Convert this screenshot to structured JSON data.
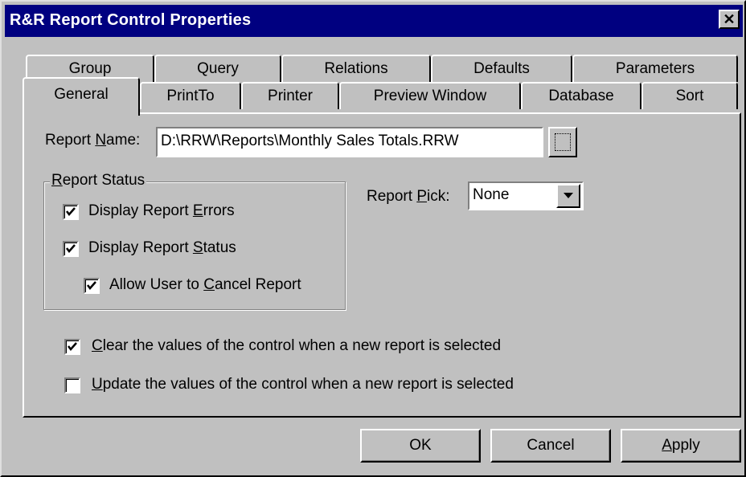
{
  "window": {
    "title": "R&R Report Control Properties"
  },
  "tabs_back": [
    {
      "label": "Group"
    },
    {
      "label": "Query"
    },
    {
      "label": "Relations"
    },
    {
      "label": "Defaults"
    },
    {
      "label": "Parameters"
    }
  ],
  "tabs_front": [
    {
      "label": "General",
      "active": true
    },
    {
      "label": "PrintTo"
    },
    {
      "label": "Printer"
    },
    {
      "label": "Preview Window"
    },
    {
      "label": "Database"
    },
    {
      "label": "Sort"
    }
  ],
  "general": {
    "report_name_label_pre": "Report ",
    "report_name_label_u": "N",
    "report_name_label_post": "ame:",
    "report_name_value": "D:\\RRW\\Reports\\Monthly Sales Totals.RRW",
    "report_status": {
      "title_u": "R",
      "title_post": "eport Status",
      "display_errors": {
        "pre": "Display Report ",
        "u": "E",
        "post": "rrors",
        "checked": true
      },
      "display_status": {
        "pre": "Display Report ",
        "u": "S",
        "post": "tatus",
        "checked": true
      },
      "allow_cancel": {
        "pre": "Allow User to ",
        "u": "C",
        "post": "ancel Report",
        "checked": true
      }
    },
    "report_pick": {
      "label_pre": "Report ",
      "label_u": "P",
      "label_post": "ick:",
      "value": "None"
    },
    "clear_values": {
      "u": "C",
      "post": "lear the values of the control when a new report is selected",
      "checked": true
    },
    "update_values": {
      "u": "U",
      "post": "pdate the values of the control when a new report is selected",
      "checked": false
    }
  },
  "buttons": {
    "ok": "OK",
    "cancel": "Cancel",
    "apply_u": "A",
    "apply_post": "pply"
  }
}
